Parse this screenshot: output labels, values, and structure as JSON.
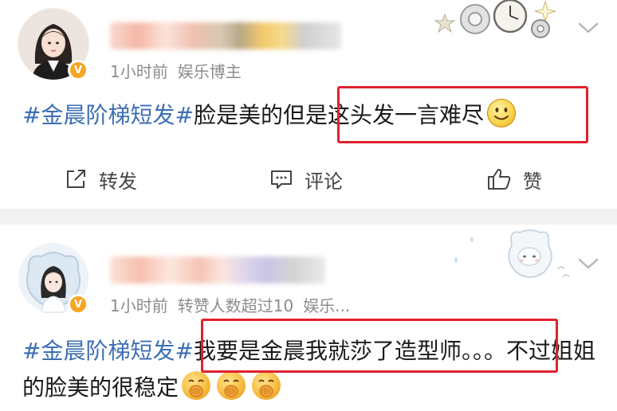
{
  "posts": [
    {
      "time": "1小时前",
      "source": "娱乐博主",
      "hashtag": "#金晨阶梯短发#",
      "text_before": "脸是美的但",
      "text_highlight": "是这头发一言难尽",
      "emoji": "smile-emoji",
      "verified_badge": "V",
      "actions": {
        "repost_label": "转发",
        "comment_label": "评论",
        "like_label": "赞"
      }
    },
    {
      "time": "1小时前",
      "source": "转赞人数超过10",
      "extra": "娱乐...",
      "hashtag": "#金晨阶梯短发#",
      "text_highlight": "我要是金晨我就莎了造型师。。。",
      "text_after": "不过姐姐的脸美的很稳定",
      "emoji": "shushing-face-emoji",
      "verified_badge": "V"
    }
  ],
  "colors": {
    "hashtag": "#3d6fb3",
    "highlight_box": "#e0212e",
    "meta_text": "#8c8c8c",
    "divider": "#f2f2f2",
    "verified_badge": "#f5a623"
  }
}
